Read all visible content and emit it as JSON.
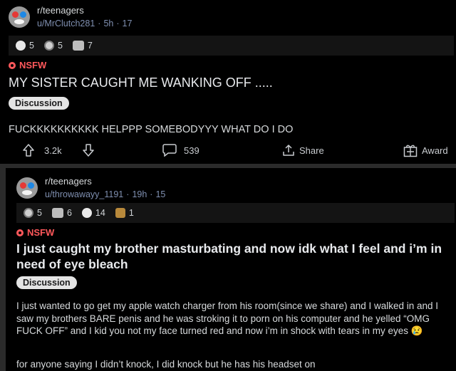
{
  "post1": {
    "subreddit": "r/teenagers",
    "username": "u/MrClutch281",
    "time": "5h",
    "views": "17",
    "awards": [
      {
        "icon": "wholesome-award-icon",
        "count": "5"
      },
      {
        "icon": "silver-award-icon",
        "count": "5"
      },
      {
        "icon": "helpful-award-icon",
        "count": "7"
      }
    ],
    "nsfw_label": "NSFW",
    "title": "MY SISTER CAUGHT ME WANKING OFF .....",
    "flair": "Discussion",
    "body": "FUCKKKKKKKKKK HELPPP SOMEBODYYY WHAT DO I DO",
    "upvotes": "3.2k",
    "comments": "539",
    "share_label": "Share",
    "award_label": "Award"
  },
  "post2": {
    "subreddit": "r/teenagers",
    "username": "u/throwawayy_1191",
    "time": "19h",
    "views": "15",
    "awards": [
      {
        "icon": "silver-award-icon",
        "count": "5"
      },
      {
        "icon": "helpful-award-icon",
        "count": "6"
      },
      {
        "icon": "wholesome-award-icon",
        "count": "14"
      },
      {
        "icon": "gold-award-icon",
        "count": "1"
      }
    ],
    "nsfw_label": "NSFW",
    "title": "I just caught my brother masturbating and now idk what I feel and i’m in need of eye bleach",
    "flair": "Discussion",
    "body_p1": "I just wanted to go get my apple watch charger from his room(since we share) and I walked in and I saw my brothers BARE penis and he was stroking it to porn on his computer and he yelled “OMG FUCK OFF” and I kid you not my face turned red and now i’m in shock with tears in my eyes",
    "body_p1_emoji": "😢",
    "body_p2": "for anyone saying I didn’t knock, I did knock but he has his headset on"
  },
  "colors": {
    "background": "#000000",
    "nsfw": "#ff585b",
    "username": "#7f8fb0",
    "flair_bg": "#e4e4e4"
  }
}
